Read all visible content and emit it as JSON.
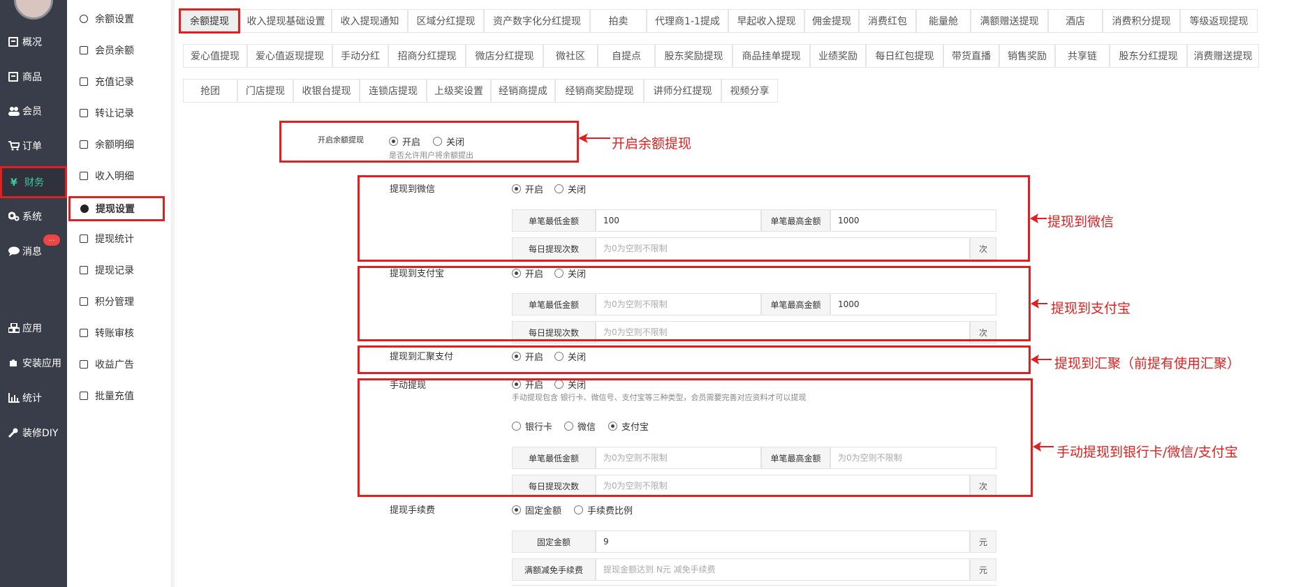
{
  "main_nav": [
    {
      "label": "概况",
      "icon": "box-icon"
    },
    {
      "label": "商品",
      "icon": "box-icon"
    },
    {
      "label": "会员",
      "icon": "users-icon"
    },
    {
      "label": "订单",
      "icon": "cart-icon"
    },
    {
      "label": "财务",
      "icon": "yen-icon"
    },
    {
      "label": "系统",
      "icon": "gears-icon"
    },
    {
      "label": "消息",
      "icon": "chat-icon"
    },
    {
      "label": "应用",
      "icon": "cubes-icon"
    },
    {
      "label": "安装应用",
      "icon": "puzzle-icon"
    },
    {
      "label": "统计",
      "icon": "bar-chart-icon"
    },
    {
      "label": "装修DIY",
      "icon": "wrench-icon"
    }
  ],
  "message_badge": "...",
  "sub_nav": [
    {
      "label": "余额设置",
      "icon": "gear-icon"
    },
    {
      "label": "会员余额",
      "icon": "book-icon"
    },
    {
      "label": "充值记录",
      "icon": "download-icon"
    },
    {
      "label": "转让记录",
      "icon": "external-link-icon"
    },
    {
      "label": "余额明细",
      "icon": "file-icon"
    },
    {
      "label": "收入明细",
      "icon": "file-icon"
    },
    {
      "label": "提现设置",
      "icon": "gear-icon"
    },
    {
      "label": "提现统计",
      "icon": "line-chart-icon"
    },
    {
      "label": "提现记录",
      "icon": "pencil-icon"
    },
    {
      "label": "积分管理",
      "icon": "database-icon"
    },
    {
      "label": "转账审核",
      "icon": "file-icon"
    },
    {
      "label": "收益广告",
      "icon": "image-icon"
    },
    {
      "label": "批量充值",
      "icon": "line-chart-icon"
    }
  ],
  "tabs_row1": [
    "余额提现",
    "收入提现基础设置",
    "收入提现通知",
    "区域分红提现",
    "资产数字化分红提现",
    "拍卖",
    "代理商1-1提成",
    "早起收入提现",
    "佣金提现",
    "消费红包",
    "能量舱",
    "满额赠送提现",
    "酒店",
    "消费积分提现",
    "等级返现提现"
  ],
  "tabs_row2": [
    "爱心值提现",
    "爱心值返现提现",
    "手动分红",
    "招商分红提现",
    "微店分红提现",
    "微社区",
    "自提点",
    "股东奖励提现",
    "商品挂单提现",
    "业绩奖励",
    "每日红包提现",
    "带货直播",
    "销售奖励",
    "共享链",
    "股东分红提现",
    "消费赠送提现"
  ],
  "tabs_row3": [
    "抢团",
    "门店提现",
    "收银台提现",
    "连锁店提现",
    "上级奖设置",
    "经销商提成",
    "经销商奖励提现",
    "讲师分红提现",
    "视频分享"
  ],
  "form": {
    "balance_withdraw": {
      "label": "开启余额提现",
      "on": "开启",
      "off": "关闭",
      "hint": "是否允许用户将余额提出"
    },
    "wechat": {
      "label": "提现到微信",
      "on": "开启",
      "off": "关闭",
      "min_label": "单笔最低金额",
      "min_value": "100",
      "max_label": "单笔最高金额",
      "max_value": "1000",
      "daily_label": "每日提现次数",
      "daily_placeholder": "为0为空则不限制",
      "suffix": "次"
    },
    "alipay": {
      "label": "提现到支付宝",
      "on": "开启",
      "off": "关闭",
      "min_label": "单笔最低金额",
      "min_placeholder": "为0为空则不限制",
      "max_label": "单笔最高金额",
      "max_value": "1000",
      "daily_label": "每日提现次数",
      "daily_placeholder": "为0为空则不限制",
      "suffix": "次"
    },
    "huiju": {
      "label": "提现到汇聚支付",
      "on": "开启",
      "off": "关闭"
    },
    "manual": {
      "label": "手动提现",
      "on": "开启",
      "off": "关闭",
      "hint": "手动提现包含 银行卡、微信号、支付宝等三种类型，会员需要完善对应资料才可以提现",
      "type_bank": "银行卡",
      "type_wechat": "微信",
      "type_alipay": "支付宝",
      "min_label": "单笔最低金额",
      "min_placeholder": "为0为空则不限制",
      "max_label": "单笔最高金额",
      "max_placeholder": "为0为空则不限制",
      "daily_label": "每日提现次数",
      "daily_placeholder": "为0为空则不限制",
      "suffix": "次"
    },
    "fee": {
      "label": "提现手续费",
      "fixed": "固定金额",
      "ratio": "手续费比例",
      "fixed_label": "固定金额",
      "fixed_value": "9",
      "fixed_suffix": "元",
      "waive_label": "满额减免手续费",
      "waive_placeholder": "提现金额达到 N元 减免手续费",
      "waive_suffix": "元"
    }
  },
  "annotations": {
    "balance": "开启余额提现",
    "wechat": "提现到微信",
    "alipay": "提现到支付宝",
    "huiju": "提现到汇聚（前提有使用汇聚）",
    "manual": "手动提现到银行卡/微信/支付宝"
  },
  "colors": {
    "sidebar": "#393d49",
    "accent": "#3cc8a0",
    "annotation": "#e02020"
  }
}
